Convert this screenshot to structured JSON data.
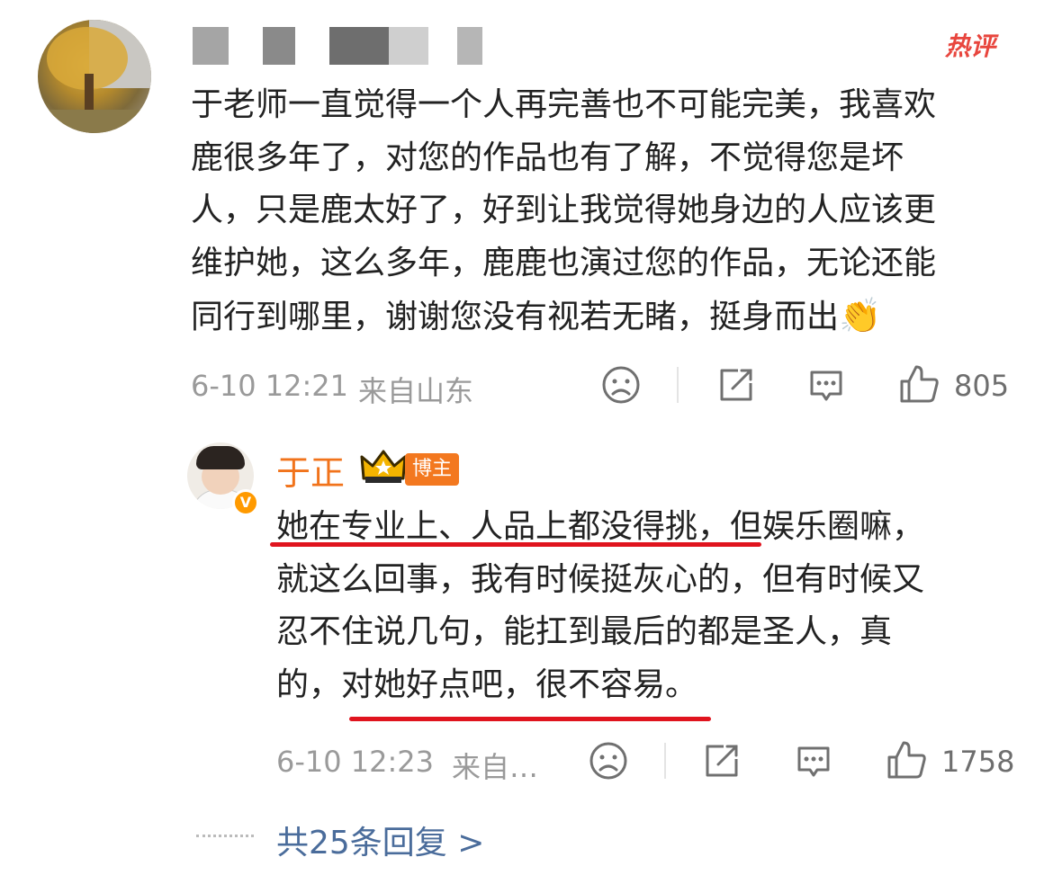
{
  "comment": {
    "badge": "热评",
    "text_lines": [
      "于老师一直觉得一个人再完善也不可能完美，我喜欢",
      "鹿很多年了，对您的作品也有了解，不觉得您是坏",
      "人，只是鹿太好了，好到让我觉得她身边的人应该更",
      "维护她，这么多年，鹿鹿也演过您的作品，无论还能",
      "同行到哪里，谢谢您没有视若无睹，挺身而出"
    ],
    "emoji": "👏",
    "time": "6-10 12:21",
    "location": "来自山东",
    "likes": "805"
  },
  "reply": {
    "author": "于正",
    "author_badge": "博主",
    "verified_mark": "V",
    "text_lines": [
      "她在专业上、人品上都没得挑，但娱乐圈嘛，",
      "就这么回事，我有时候挺灰心的，但有时候又",
      "忍不住说几句，能扛到最后的都是圣人，真",
      "的，对她好点吧，很不容易。"
    ],
    "time": "6-10 12:23",
    "location": "来自…",
    "likes": "1758"
  },
  "more_replies": "共25条回复 >",
  "colors": {
    "hot": "#e8463e",
    "author": "#f1731b",
    "link": "#4a6c9b",
    "underline": "#e0141e",
    "meta": "#9a9a9a"
  },
  "icons": [
    "dislike-icon",
    "share-icon",
    "comment-icon",
    "like-icon",
    "crown-icon"
  ]
}
